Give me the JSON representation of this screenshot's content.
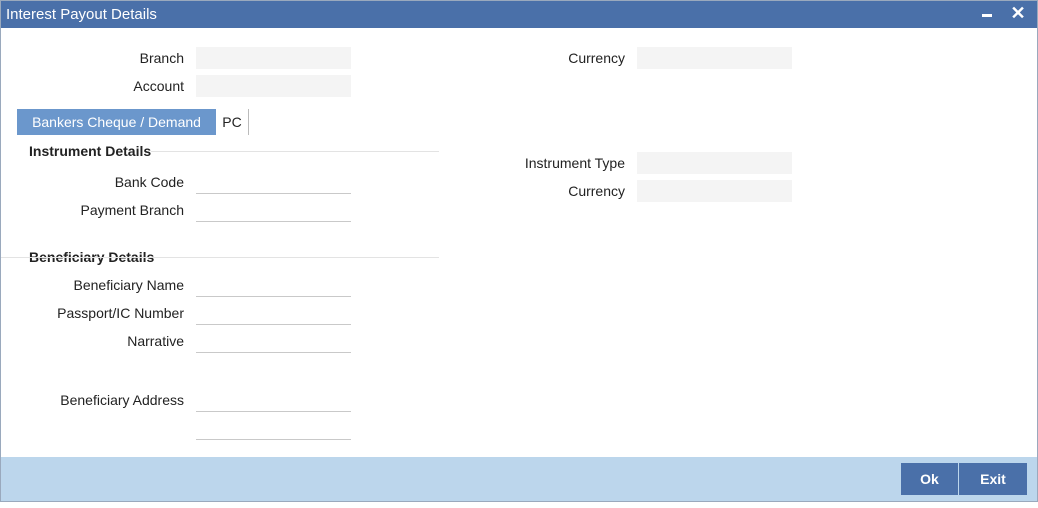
{
  "window": {
    "title": "Interest Payout Details",
    "minimize_icon": "minimize-icon",
    "close_icon": "close-icon",
    "close_glyph": "✕"
  },
  "header": {
    "branch_label": "Branch",
    "branch_value": "",
    "account_label": "Account",
    "account_value": "",
    "currency_label": "Currency",
    "currency_value": ""
  },
  "tabs": [
    {
      "label": "Bankers Cheque / Demand Draft",
      "active": true
    },
    {
      "label": "PC",
      "active": false
    }
  ],
  "instrument": {
    "title": "Instrument Details",
    "bank_code_label": "Bank Code",
    "bank_code_value": "",
    "payment_branch_label": "Payment Branch",
    "payment_branch_value": "",
    "instrument_type_label": "Instrument Type",
    "instrument_type_value": "",
    "currency_label": "Currency",
    "currency_value": ""
  },
  "beneficiary": {
    "title": "Beneficiary Details",
    "name_label": "Beneficiary Name",
    "name_value": "",
    "passport_label": "Passport/IC Number",
    "passport_value": "",
    "narrative_label": "Narrative",
    "narrative_value": "",
    "address_label": "Beneficiary Address",
    "address_line1": "",
    "address_line2": ""
  },
  "footer": {
    "ok_label": "Ok",
    "exit_label": "Exit"
  },
  "colors": {
    "titlebar": "#4a70a9",
    "active_tab": "#6b97cc",
    "footer": "#bcd6ec",
    "button": "#4a70a9"
  }
}
